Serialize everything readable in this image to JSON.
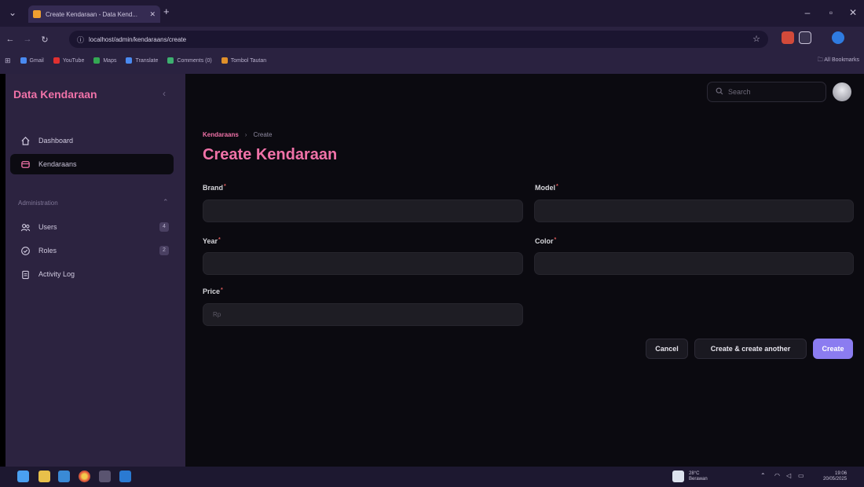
{
  "browser": {
    "tab_title": "Create Kendaraan - Data Kend...",
    "url": "localhost/admin/kendaraans/create",
    "bookmarks": [
      "Gmail",
      "YouTube",
      "Maps",
      "Translate",
      "Comments (0)",
      "Tombol Tautan"
    ],
    "all_bookmarks": "All Bookmarks"
  },
  "sidebar": {
    "brand": "Data Kendaraan",
    "items": [
      {
        "label": "Dashboard",
        "icon": "home-icon"
      },
      {
        "label": "Kendaraans",
        "icon": "car-icon"
      }
    ],
    "group_label": "Administration",
    "admin_items": [
      {
        "label": "Users",
        "badge": "4",
        "icon": "users-icon"
      },
      {
        "label": "Roles",
        "badge": "2",
        "icon": "shield-check-icon"
      },
      {
        "label": "Activity Log",
        "icon": "clipboard-icon"
      }
    ]
  },
  "topbar": {
    "search_placeholder": "Search"
  },
  "page": {
    "breadcrumb_parent": "Kendaraans",
    "breadcrumb_separator": "›",
    "breadcrumb_current": "Create",
    "title": "Create Kendaraan"
  },
  "form": {
    "fields": [
      {
        "label": "Brand",
        "required": "*",
        "value": "",
        "placeholder": ""
      },
      {
        "label": "Model",
        "required": "*",
        "value": "",
        "placeholder": ""
      },
      {
        "label": "Year",
        "required": "*",
        "value": "",
        "placeholder": ""
      },
      {
        "label": "Color",
        "required": "*",
        "value": "",
        "placeholder": ""
      },
      {
        "label": "Price",
        "required": "*",
        "value": "",
        "placeholder": "Rp"
      }
    ],
    "buttons": {
      "cancel": "Cancel",
      "create_another": "Create & create another",
      "create": "Create"
    }
  },
  "taskbar": {
    "weather_temp": "28°C",
    "weather_desc": "Berawan",
    "time": "19:06",
    "date": "20/05/2025"
  },
  "colors": {
    "accent_pink": "#f072a8",
    "primary_button": "#8b7cf0",
    "sidebar_bg": "#2c2340",
    "main_bg": "#0b0a10"
  }
}
